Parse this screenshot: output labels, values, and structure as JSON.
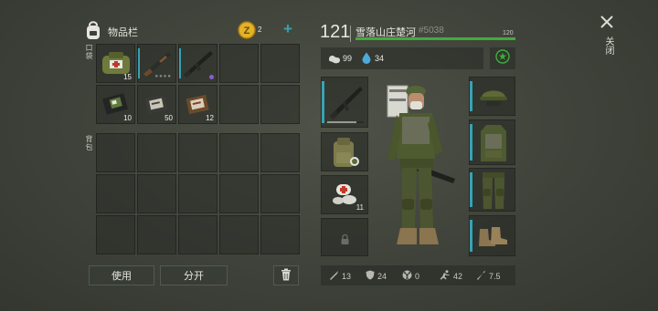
{
  "inventory": {
    "title": "物品栏",
    "pocket_label": "口袋",
    "backpack_label": "背包",
    "coin_count": "2",
    "add_symbol": "+",
    "pocket_items": [
      {
        "name": "bandage-bag",
        "count": "15"
      },
      {
        "name": "shotgun",
        "count": ""
      },
      {
        "name": "assault-rifle",
        "count": ""
      },
      {
        "name": "empty",
        "count": ""
      },
      {
        "name": "empty",
        "count": ""
      },
      {
        "name": "notebook",
        "count": "10"
      },
      {
        "name": "ammo-box",
        "count": "50"
      },
      {
        "name": "ammo-box-2",
        "count": "12"
      },
      {
        "name": "empty",
        "count": ""
      },
      {
        "name": "empty",
        "count": ""
      }
    ],
    "use_button": "使用",
    "split_button": "分开"
  },
  "player": {
    "level": "121",
    "name": "雪落山庄楚河",
    "id": "#5038",
    "hp_max": "120",
    "hp_fraction": 1.0,
    "food": "99",
    "water": "34"
  },
  "equipment": {
    "weapon_ammo_fraction": 0.8,
    "medkit_count": "11"
  },
  "stats": {
    "attack": "13",
    "defense": "24",
    "radiation": "0",
    "speed": "42",
    "weapon_stat": "7.5"
  },
  "close_label": "关闭",
  "colors": {
    "accent": "#36a3b5",
    "hp_green": "#3fae3a",
    "coin_gold": "#e3b22a"
  }
}
